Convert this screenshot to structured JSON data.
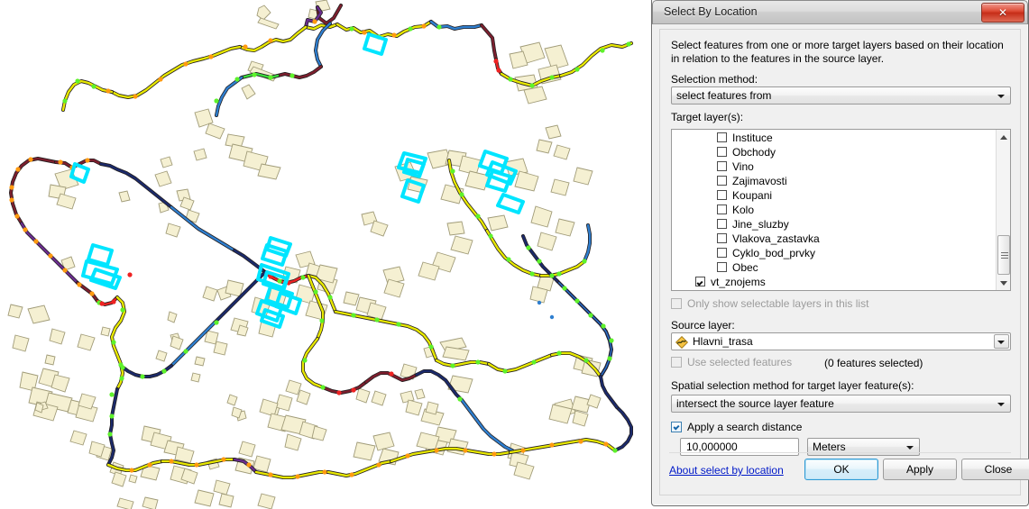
{
  "window": {
    "title": "Select By Location",
    "close_icon": "close-x-icon"
  },
  "dialog": {
    "intro": "Select features from one or more target layers based on their location in relation to the features in the source layer.",
    "selection_method_label": "Selection method:",
    "selection_method_value": "select features from",
    "target_layers_label": "Target layer(s):",
    "target_layers": [
      {
        "label": "Instituce",
        "checked": false,
        "indent": 1
      },
      {
        "label": "Obchody",
        "checked": false,
        "indent": 1
      },
      {
        "label": "Vino",
        "checked": false,
        "indent": 1
      },
      {
        "label": "Zajimavosti",
        "checked": false,
        "indent": 1
      },
      {
        "label": "Koupani",
        "checked": false,
        "indent": 1
      },
      {
        "label": "Kolo",
        "checked": false,
        "indent": 1
      },
      {
        "label": "Jine_sluzby",
        "checked": false,
        "indent": 1
      },
      {
        "label": "Vlakova_zastavka",
        "checked": false,
        "indent": 1
      },
      {
        "label": "Cyklo_bod_prvky",
        "checked": false,
        "indent": 1
      },
      {
        "label": "Obec",
        "checked": false,
        "indent": 1
      },
      {
        "label": "vt_znojems",
        "checked": true,
        "indent": 0
      }
    ],
    "only_selectable_label": "Only show selectable layers in this list",
    "only_selectable_checked": false,
    "source_layer_label": "Source layer:",
    "source_layer_value": "Hlavni_trasa",
    "source_layer_icon": "polyline-symbol-icon",
    "use_selected_label": "Use selected features",
    "use_selected_checked": false,
    "use_selected_disabled": true,
    "features_selected_text": "(0 features selected)",
    "spatial_method_label": "Spatial selection method for target layer feature(s):",
    "spatial_method_value": "intersect the source layer feature",
    "apply_distance_label": "Apply a search distance",
    "apply_distance_checked": true,
    "search_distance_value": "10,000000",
    "distance_unit_value": "Meters",
    "about_link": "About select by location",
    "ok_label": "OK",
    "apply_label": "Apply",
    "close_label": "Close"
  },
  "map": {
    "name": "gis-map-view",
    "colors": {
      "polygon_fill": "#f5f0d2",
      "polygon_stroke": "#a09b78",
      "selection_cyan": "#00e5ff",
      "route_navy": "#1b2a6b",
      "route_blue": "#2f7fd0",
      "route_yellow": "#e8e800",
      "route_green": "#3cdd3c",
      "route_purple": "#6a2d8f",
      "route_maroon": "#7d1f2e",
      "route_orange": "#ff9a10",
      "route_red": "#ee2222",
      "background": "#ffffff"
    }
  }
}
